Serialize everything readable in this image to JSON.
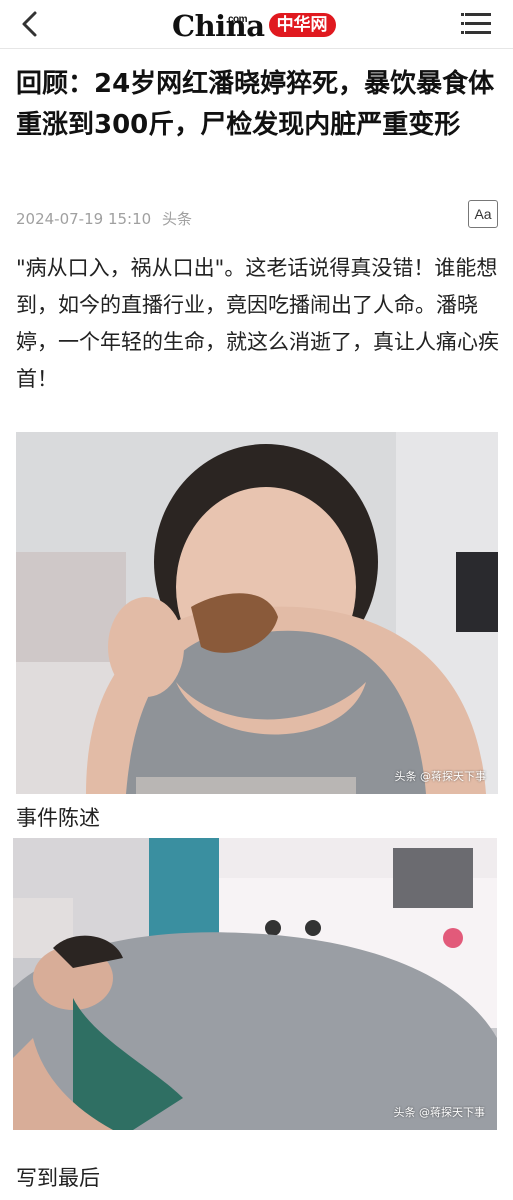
{
  "header": {
    "logo_text": "China",
    "logo_com": "com",
    "logo_red": "中华网"
  },
  "icons": {
    "back": "chevron-left-icon",
    "menu": "hamburger-menu-icon",
    "font_size": "font-size-icon"
  },
  "colors": {
    "brand_red": "#e0191f",
    "meta_gray": "#a0a0a0"
  },
  "article": {
    "title": "回顾：24岁网红潘晓婷猝死，暴饮暴食体重涨到300斤，尸检发现内脏严重变形",
    "date": "2024-07-19 15:10",
    "source": "头条",
    "font_button": "Aa",
    "intro": "\"病从口入，祸从口出\"。这老话说得真没错！谁能想到，如今的直播行业，竟因吃播闹出了人命。潘晓婷，一个年轻的生命，就这么消逝了，真让人痛心疾首！",
    "image1_watermark": "头条 @蒋探天下事",
    "section1": "事件陈述",
    "image2_watermark": "头条 @蒋探天下事",
    "section2": "写到最后"
  }
}
